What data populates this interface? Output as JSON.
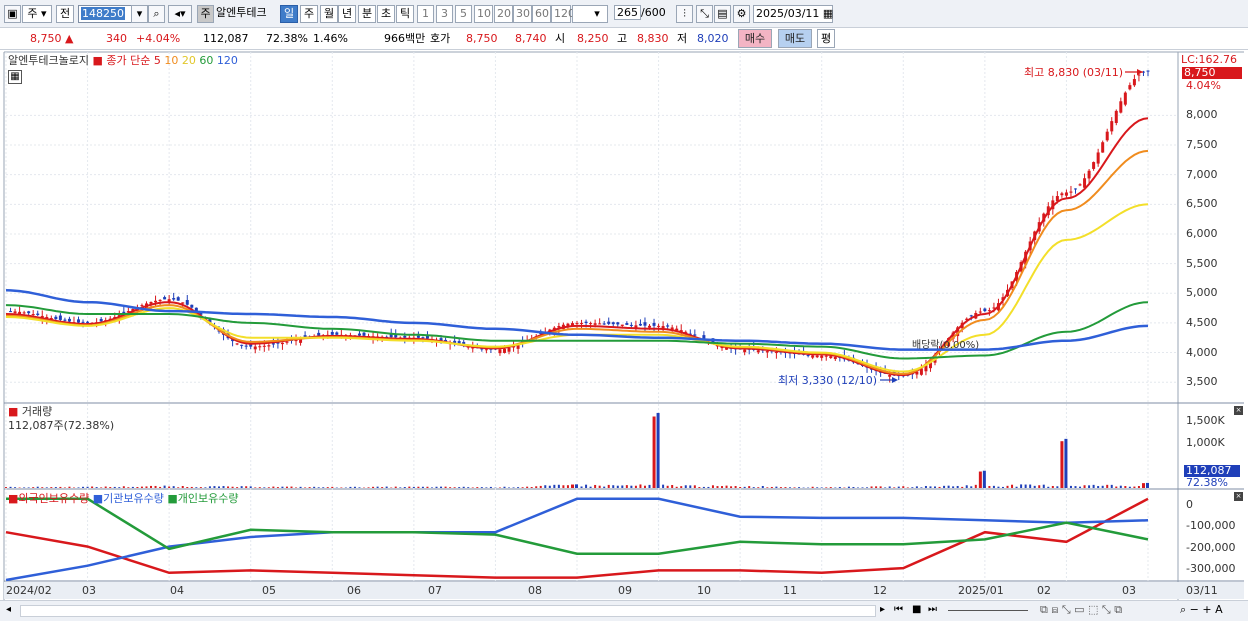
{
  "toolbar": {
    "market_type": "주",
    "prefix": "전",
    "stock_code": "148250",
    "stock_tag": "주",
    "stock_name": "알엔투테크",
    "periods": [
      "일",
      "주",
      "월",
      "년",
      "분",
      "초",
      "틱"
    ],
    "selected_period": "일",
    "intervals": [
      "1",
      "3",
      "5",
      "10",
      "20",
      "30",
      "60",
      "120"
    ],
    "count": "265",
    "count_total": "/600",
    "date": "2025/03/11"
  },
  "quote": {
    "price": "8,750",
    "change": "340",
    "change_pct": "+4.04%",
    "volume": "112,087",
    "volume_ratio": "72.38%",
    "turnover": "1.46%",
    "amount": "966백만",
    "hoga_label": "호가",
    "ask": "8,750",
    "bid": "8,740",
    "open_label": "시",
    "open": "8,250",
    "high_label": "고",
    "high": "8,830",
    "low_label": "저",
    "low": "8,020",
    "buy_label": "매수",
    "sell_label": "매도",
    "eval_label": "평"
  },
  "price_panel": {
    "name": "알엔투테크놀로지",
    "ma_label": "종가 단순",
    "ma_periods": [
      "5",
      "10",
      "20",
      "60",
      "120"
    ],
    "ma_colors": [
      "#d8181c",
      "#f08c1e",
      "#f3df2a",
      "#239b3a",
      "#2f5fd8"
    ],
    "lc_label": "LC:162.76",
    "last_price_tag": "8,750",
    "last_pct_tag": "4.04%",
    "high_annotation": "최고 8,830 (03/11)",
    "low_annotation": "최저 3,330 (12/10)",
    "dividend_annotation": "배당락(0.00%)",
    "y_ticks": [
      "8,000",
      "7,500",
      "7,000",
      "6,500",
      "6,000",
      "5,500",
      "5,000",
      "4,500",
      "4,000",
      "3,500"
    ]
  },
  "volume_panel": {
    "title": "거래량",
    "current": "112,087주(72.38%)",
    "y_ticks": [
      "1,500K",
      "1,000K"
    ],
    "tag_value": "112,087",
    "tag_pct": "72.38%"
  },
  "holdings_panel": {
    "series_labels": [
      "외국인보유수량",
      "기관보유수량",
      "개인보유수량"
    ],
    "series_colors": [
      "#d8181c",
      "#2f5fd8",
      "#239b3a"
    ],
    "y_ticks": [
      "0",
      "-100,000",
      "-200,000",
      "-300,000"
    ]
  },
  "x_axis": {
    "labels": [
      "2024/02",
      "03",
      "04",
      "05",
      "06",
      "07",
      "08",
      "09",
      "10",
      "11",
      "12",
      "2025/01",
      "02",
      "03",
      "03/11"
    ]
  },
  "chart_data": [
    {
      "type": "line",
      "title": "알엔투테크놀로지",
      "ylabel": "",
      "ylim": [
        3200,
        8900
      ],
      "x": [
        "2024/02",
        "03",
        "04",
        "05",
        "06",
        "07",
        "08",
        "09",
        "10",
        "11",
        "12",
        "2025/01",
        "02",
        "03",
        "03/11"
      ],
      "series": [
        {
          "name": "종가",
          "values": [
            4700,
            4500,
            4900,
            4100,
            4300,
            4250,
            4050,
            4500,
            4450,
            4050,
            3950,
            3600,
            4700,
            6700,
            8750
          ]
        },
        {
          "name": "5",
          "values": [
            4650,
            4480,
            4850,
            4150,
            4280,
            4230,
            4070,
            4450,
            4400,
            4070,
            3970,
            3620,
            4650,
            6600,
            7950
          ]
        },
        {
          "name": "10",
          "values": [
            4620,
            4460,
            4800,
            4180,
            4260,
            4210,
            4090,
            4400,
            4350,
            4090,
            3990,
            3640,
            4550,
            6400,
            7400
          ]
        },
        {
          "name": "20",
          "values": [
            4600,
            4450,
            4750,
            4250,
            4250,
            4200,
            4100,
            4300,
            4300,
            4100,
            4000,
            3680,
            4300,
            5900,
            6500
          ]
        },
        {
          "name": "60",
          "values": [
            4800,
            4650,
            4650,
            4500,
            4400,
            4300,
            4200,
            4200,
            4200,
            4150,
            4100,
            3900,
            3950,
            4350,
            4850
          ]
        },
        {
          "name": "120",
          "values": [
            5050,
            4850,
            4700,
            4650,
            4600,
            4500,
            4400,
            4300,
            4250,
            4200,
            4150,
            4050,
            4050,
            4200,
            4450
          ]
        }
      ],
      "annotations": [
        "최고 8,830 (03/11)",
        "최저 3,330 (12/10)"
      ]
    },
    {
      "type": "bar",
      "title": "거래량",
      "ylim": [
        0,
        1800000
      ],
      "x": [
        "2024/02",
        "03",
        "04",
        "05",
        "06",
        "07",
        "08",
        "09",
        "10",
        "11",
        "12",
        "2025/01",
        "02",
        "03",
        "03/11"
      ],
      "values": [
        20000,
        25000,
        40000,
        30000,
        20000,
        25000,
        20000,
        80000,
        1650000,
        40000,
        20000,
        30000,
        380000,
        1080000,
        112087
      ]
    },
    {
      "type": "line",
      "title": "보유수량",
      "ylim": [
        -340000,
        20000
      ],
      "x": [
        "2024/02",
        "03",
        "04",
        "05",
        "06",
        "07",
        "08",
        "09",
        "10",
        "11",
        "12",
        "2025/01",
        "02",
        "03",
        "03/11"
      ],
      "series": [
        {
          "name": "외국인보유수량",
          "values": [
            -140000,
            -200000,
            -310000,
            -300000,
            -310000,
            -320000,
            -330000,
            -330000,
            -300000,
            -300000,
            -310000,
            -290000,
            -140000,
            -180000,
            0
          ]
        },
        {
          "name": "기관보유수량",
          "values": [
            -340000,
            -280000,
            -200000,
            -160000,
            -140000,
            -140000,
            -140000,
            0,
            0,
            -75000,
            -80000,
            -80000,
            -90000,
            -100000,
            -90000
          ]
        },
        {
          "name": "개인보유수량",
          "values": [
            0,
            0,
            -210000,
            -130000,
            -140000,
            -140000,
            -150000,
            -230000,
            -230000,
            -180000,
            -190000,
            -190000,
            -170000,
            -100000,
            -170000
          ]
        }
      ]
    }
  ]
}
